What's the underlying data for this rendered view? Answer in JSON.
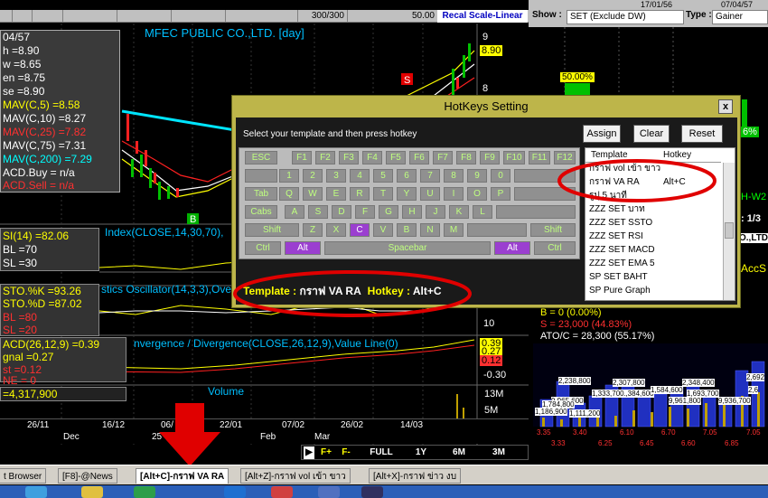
{
  "chart": {
    "title": "MFEC PUBLIC CO.,LTD. [day]",
    "toolbar_values": [
      "300/300",
      "50.00"
    ],
    "recal": "Recal Scale-Linear",
    "info": [
      {
        "text": "04/57",
        "color": "#ffffff"
      },
      {
        "text": "h   =8.90",
        "color": "#ffffff"
      },
      {
        "text": "w   =8.65",
        "color": "#ffffff"
      },
      {
        "text": "en  =8.75",
        "color": "#ffffff"
      },
      {
        "text": "se  =8.90",
        "color": "#ffffff"
      },
      {
        "text": "MAV(C,5)      =8.58",
        "color": "#ffff00"
      },
      {
        "text": "MAV(C,10)    =8.27",
        "color": "#ffffff"
      },
      {
        "text": "MAV(C,25)    =7.82",
        "color": "#ff3030"
      },
      {
        "text": "MAV(C,75)    =7.31",
        "color": "#ffffff"
      },
      {
        "text": "MAV(C,200)   =7.29",
        "color": "#00ffff"
      },
      {
        "text": "ACD.Buy  = n/a",
        "color": "#ffffff"
      },
      {
        "text": "ACD.Sell  = n/a",
        "color": "#ff3030"
      }
    ],
    "price_ticks": [
      "9",
      "8.90",
      "8"
    ],
    "rsi_panel": [
      {
        "text": "SI(14)  =82.06",
        "color": "#ffff00"
      },
      {
        "text": "BL    =70",
        "color": "#ffffff"
      },
      {
        "text": "SL    =30",
        "color": "#ffffff"
      }
    ],
    "rsi_label": "Index(CLOSE,14,30,70),",
    "sto_panel": [
      {
        "text": "STO.%K   =93.26",
        "color": "#ffff00"
      },
      {
        "text": "STO.%D   =87.02",
        "color": "#ffffff"
      },
      {
        "text": "BL    =80",
        "color": "#ffffff"
      },
      {
        "text": "SL    =20",
        "color": "#ffffff"
      }
    ],
    "sto_label": "stics Oscillator(14,3,3),Ove",
    "macd_panel": [
      {
        "text": "ACD(26,12,9)  =0.39",
        "color": "#ffff00"
      },
      {
        "text": "gnal   =0.27",
        "color": "#ffff00"
      },
      {
        "text": "st    =0.12",
        "color": "#ff3030"
      },
      {
        "text": "NE    = 0",
        "color": "#ff3030"
      }
    ],
    "macd_label": "nvergence / Divergence(CLOSE,26,12,9),Value Line(0)",
    "macd_ticks": [
      "10",
      "0.39",
      "0.27",
      "0.12",
      "-0.30"
    ],
    "volume_panel": "=4,317,900",
    "volume_label": "Volume",
    "volume_ticks": [
      "13M",
      "5M"
    ],
    "markers": [
      "S",
      "B"
    ],
    "dates": [
      "26/11",
      "16/12",
      "06/",
      "22/01",
      "07/02",
      "26/02",
      "14/03"
    ],
    "dates2": [
      "Dec",
      "25",
      "Feb",
      "Mar"
    ],
    "nav": [
      "F+",
      "F-",
      "FULL",
      "1Y",
      "6M",
      "3M"
    ]
  },
  "right_panel": {
    "show_label": "Show :",
    "show_value": "SET (Exclude DW)",
    "type_label": "Type :",
    "type_value": "Gainer",
    "date1": "17/01/56",
    "date2": "07/04/57",
    "pct": "50.00%",
    "pct2": "6%",
    "label_hw": "H-W2",
    "label_1": ": 1/3",
    "label_o": "O.,LTD",
    "label_acc": "AccS",
    "b_stat": "B = 0 (0.00%)",
    "s_stat": "S = 23,000 (44.83%)",
    "ato_stat": "ATO/C = 28,300 (55.17%)",
    "bars": [
      "2,238,800",
      "1,186,900",
      "2,307,800",
      "1,384,600",
      "1,333,700",
      "1,584,600",
      "9,965,600",
      "1,784,800",
      "1,111,200",
      "2,348,400",
      "1,693,700",
      "9,936,700",
      "9,961,800",
      "2,692",
      "2,6"
    ],
    "prices": [
      "3.35",
      "3.33",
      "3.40",
      "6.25",
      "6.10",
      "6.45",
      "6.70",
      "6.60",
      "7.05",
      "6.85",
      "7.05"
    ]
  },
  "dialog": {
    "title": "HotKeys Setting",
    "close": "x",
    "hint": "Select your template and then press hotkey",
    "assign": "Assign",
    "clear": "Clear",
    "reset": "Reset",
    "list_headers": [
      "Template",
      "Hotkey"
    ],
    "list_rows": [
      {
        "name": "กราฟ vol เข้า ขาว",
        "key": ""
      },
      {
        "name": "กราฟ VA RA",
        "key": "Alt+C"
      },
      {
        "name": "รูปุ 5 นาที",
        "key": ""
      },
      {
        "name": "ZZZ SET บาท",
        "key": ""
      },
      {
        "name": "ZZZ SET SSTO",
        "key": ""
      },
      {
        "name": "ZZZ SET RSI",
        "key": ""
      },
      {
        "name": "ZZZ SET MACD",
        "key": ""
      },
      {
        "name": "ZZZ SET EMA 5",
        "key": ""
      },
      {
        "name": "SP SET BAHT",
        "key": ""
      },
      {
        "name": "SP Pure Graph",
        "key": ""
      }
    ],
    "status_template_label": "Template :",
    "status_template_value": "กราฟ VA RA",
    "status_hotkey_label": "Hotkey :",
    "status_hotkey_value": "Alt+C",
    "keys_row1": [
      "ESC",
      "F1",
      "F2",
      "F3",
      "F4",
      "F5",
      "F6",
      "F7",
      "F8",
      "F9",
      "F10",
      "F11",
      "F12"
    ],
    "keys_row2": [
      "1",
      "2",
      "3",
      "4",
      "5",
      "6",
      "7",
      "8",
      "9",
      "0"
    ],
    "keys_row3": [
      "Tab",
      "Q",
      "W",
      "E",
      "R",
      "T",
      "Y",
      "U",
      "I",
      "O",
      "P"
    ],
    "keys_row4": [
      "Cabs",
      "A",
      "S",
      "D",
      "F",
      "G",
      "H",
      "J",
      "K",
      "L"
    ],
    "keys_row5": [
      "Shift",
      "Z",
      "X",
      "C",
      "V",
      "B",
      "N",
      "M",
      "Shift"
    ],
    "keys_row6": [
      "Ctrl",
      "Alt",
      "Spacebar",
      "Alt",
      "Ctrl"
    ]
  },
  "tabs": {
    "browser": "t Browser",
    "items": [
      "[F8]-@News",
      "[Alt+C]-กราฟ VA RA",
      "[Alt+Z]-กราฟ vol เข้า ขาว",
      "[Alt+X]-กราฟ ข่าว งบ"
    ]
  }
}
